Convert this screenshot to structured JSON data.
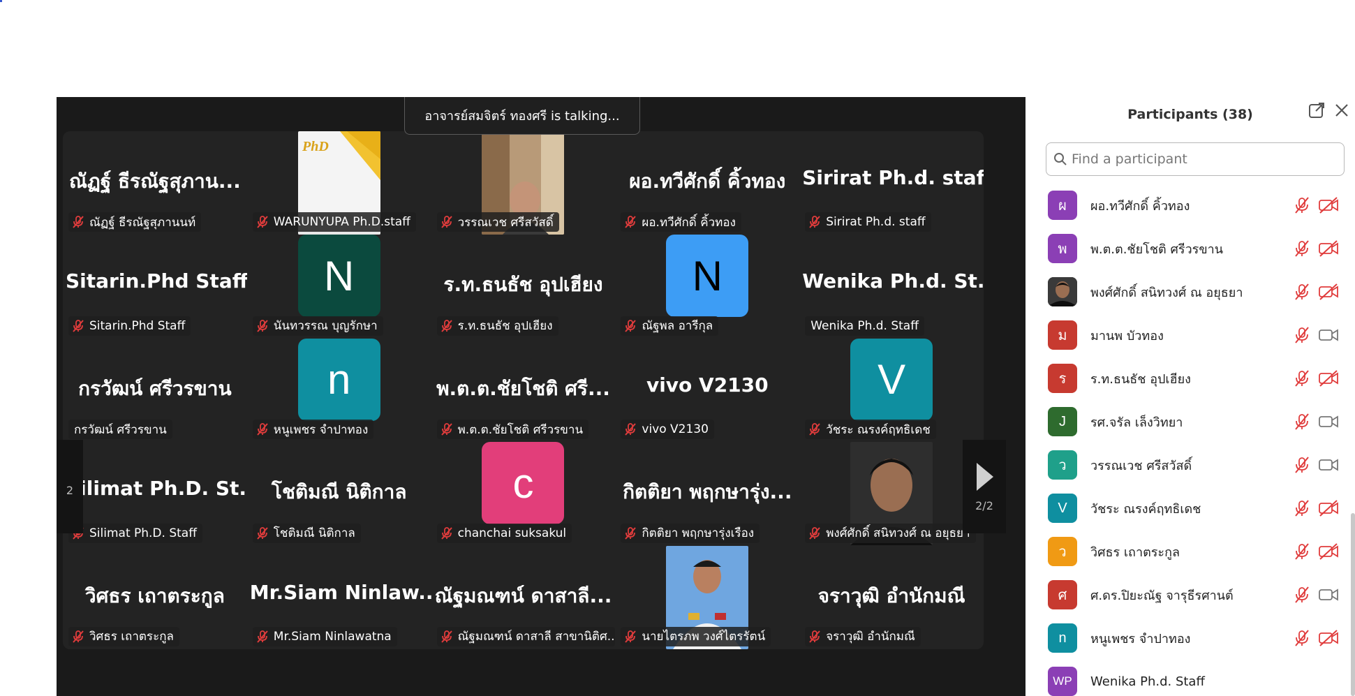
{
  "banner": {
    "talking_text": "อาจารย์สมจิตร์  ทองศรี is talking..."
  },
  "gallery": {
    "tiles": [
      {
        "big_name": "ณัฏฐ์ ธีรณัฐสุภาน...",
        "label": "ณัฏฐ์ ธีรณัฐสุภานนท์",
        "muted": true
      },
      {
        "photo": "phd-logo",
        "label": "WARUNYUPA Ph.D.staff",
        "muted": true
      },
      {
        "photo": "man-room",
        "label": "วรรณเวช ศรีสวัสดิ์",
        "muted": true
      },
      {
        "big_name": "ผอ.ทวีศักดิ์  คิ้วทอง",
        "label": "ผอ.ทวีศักดิ์  คิ้วทอง",
        "muted": true
      },
      {
        "big_name": "Sirirat Ph.d. staff",
        "label": "Sirirat Ph.d. staff",
        "muted": true
      },
      {
        "big_name": "Sitarin.Phd Staff",
        "label": "Sitarin.Phd Staff",
        "muted": true
      },
      {
        "avatar_letter": "N",
        "avatar_color": "#0b4a3e",
        "label": "นันทวรรณ บุญรักษา",
        "muted": true
      },
      {
        "big_name": "ร.ท.ธนธัช  อุปเฮียง",
        "label": "ร.ท.ธนธัช  อุปเฮียง",
        "muted": true
      },
      {
        "avatar_letter": "N",
        "avatar_color": "#3d9df5",
        "avatar_text_color": "#000000",
        "label": "ณัฐพล อารีกุล",
        "muted": true
      },
      {
        "big_name": "Wenika  Ph.d.  St...",
        "label": "Wenika Ph.d. Staff",
        "muted": false
      },
      {
        "big_name": "กรวัฒน์ ศรีวรขาน",
        "label": "กรวัฒน์ ศรีวรขาน",
        "muted": false
      },
      {
        "avatar_letter": "n",
        "avatar_color": "#0f8fa0",
        "label": "หนูเพชร จำปาทอง",
        "muted": true
      },
      {
        "big_name": "พ.ต.ต.ชัยโชติ ศรี...",
        "label": "พ.ต.ต.ชัยโชติ ศรีวรขาน",
        "muted": true
      },
      {
        "big_name": "vivo V2130",
        "label": "vivo V2130",
        "muted": true
      },
      {
        "avatar_letter": "V",
        "avatar_color": "#0f8fa0",
        "label": "วัชระ ณรงค์ฤทธิเดช",
        "muted": true
      },
      {
        "big_name": "Silimat  Ph.D.  St...",
        "label": "Silimat Ph.D. Staff",
        "muted": true
      },
      {
        "big_name": "โชติมณี นิติกาล",
        "label": "โชติมณี นิติกาล",
        "muted": true
      },
      {
        "avatar_letter": "c",
        "avatar_color": "#e23e7a",
        "label": "chanchai suksakul",
        "muted": true
      },
      {
        "big_name": "กิตติยา พฤกษารุ่ง...",
        "label": "กิตติยา พฤกษารุ่งเรือง",
        "muted": true
      },
      {
        "photo": "man-portrait",
        "label": "พงศ์ศักดิ์ สนิทวงศ์ ณ อยุธยา",
        "muted": true
      },
      {
        "big_name": "วิศธร เถาตระกูล",
        "label": "วิศธร เถาตระกูล",
        "muted": true
      },
      {
        "big_name": "Mr.Siam  Ninlaw...",
        "label": "Mr.Siam Ninlawatna",
        "muted": true
      },
      {
        "big_name": "ณัฐมณฑน์ ดาสาลี...",
        "label": "ณัฐมณฑน์ ดาสาลี สาขานิติศ...",
        "muted": true
      },
      {
        "photo": "officer-portrait",
        "label": "นายไตรภพ วงศ์ไตรรัตน์",
        "muted": true
      },
      {
        "big_name": "จราวุฒิ อำนักมณี",
        "label": "จราวุฒิ อำนักมณี",
        "muted": true
      }
    ]
  },
  "nav": {
    "left_count": "2",
    "right_count": "2/2"
  },
  "participants": {
    "title": "Participants (38)",
    "search_placeholder": "Find a participant",
    "items": [
      {
        "initial": "ผ",
        "color": "#8b3fb5",
        "name": "ผอ.ทวีศักดิ์  คิ้วทอง",
        "mic_muted": true,
        "video_off": true
      },
      {
        "initial": "พ",
        "color": "#8b3fb5",
        "name": "พ.ต.ต.ชัยโชติ ศรีวรขาน",
        "mic_muted": true,
        "video_off": true
      },
      {
        "initial": "",
        "photo": true,
        "color": "#2a2a2a",
        "name": "พงศ์ศักดิ์ สนิทวงศ์ ณ อยุธยา",
        "mic_muted": true,
        "video_off": true
      },
      {
        "initial": "ม",
        "color": "#c73a30",
        "name": "มานพ บัวทอง",
        "mic_muted": true,
        "video_off": false
      },
      {
        "initial": "ร",
        "color": "#c73a30",
        "name": "ร.ท.ธนธัช  อุปเฮียง",
        "mic_muted": true,
        "video_off": true
      },
      {
        "initial": "J",
        "color": "#2e6b2e",
        "name": "รศ.จรัล  เล็งวิทยา",
        "mic_muted": true,
        "video_off": false
      },
      {
        "initial": "ว",
        "color": "#1fa08a",
        "name": "วรรณเวช ศรีสวัสดิ์",
        "mic_muted": true,
        "video_off": false
      },
      {
        "initial": "V",
        "color": "#0f8fa0",
        "name": "วัชระ ณรงค์ฤทธิเดช",
        "mic_muted": true,
        "video_off": true
      },
      {
        "initial": "ว",
        "color": "#f09a14",
        "name": "วิศธร เถาตระกูล",
        "mic_muted": true,
        "video_off": true
      },
      {
        "initial": "ศ",
        "color": "#c73a30",
        "name": "ศ.ดร.ปิยะณัฐ  จารุธีรศานต์",
        "mic_muted": true,
        "video_off": false
      },
      {
        "initial": "n",
        "color": "#0f8fa0",
        "name": "หนูเพชร จำปาทอง",
        "mic_muted": true,
        "video_off": true
      },
      {
        "initial": "WP",
        "color": "#8b3fb5",
        "name": "Wenika Ph.d. Staff",
        "mic_muted": false,
        "video_off": false
      }
    ]
  },
  "colors": {
    "mute_red": "#e03c3c",
    "gallery_bg": "#232323",
    "stage_bg": "#1a1a1a"
  }
}
